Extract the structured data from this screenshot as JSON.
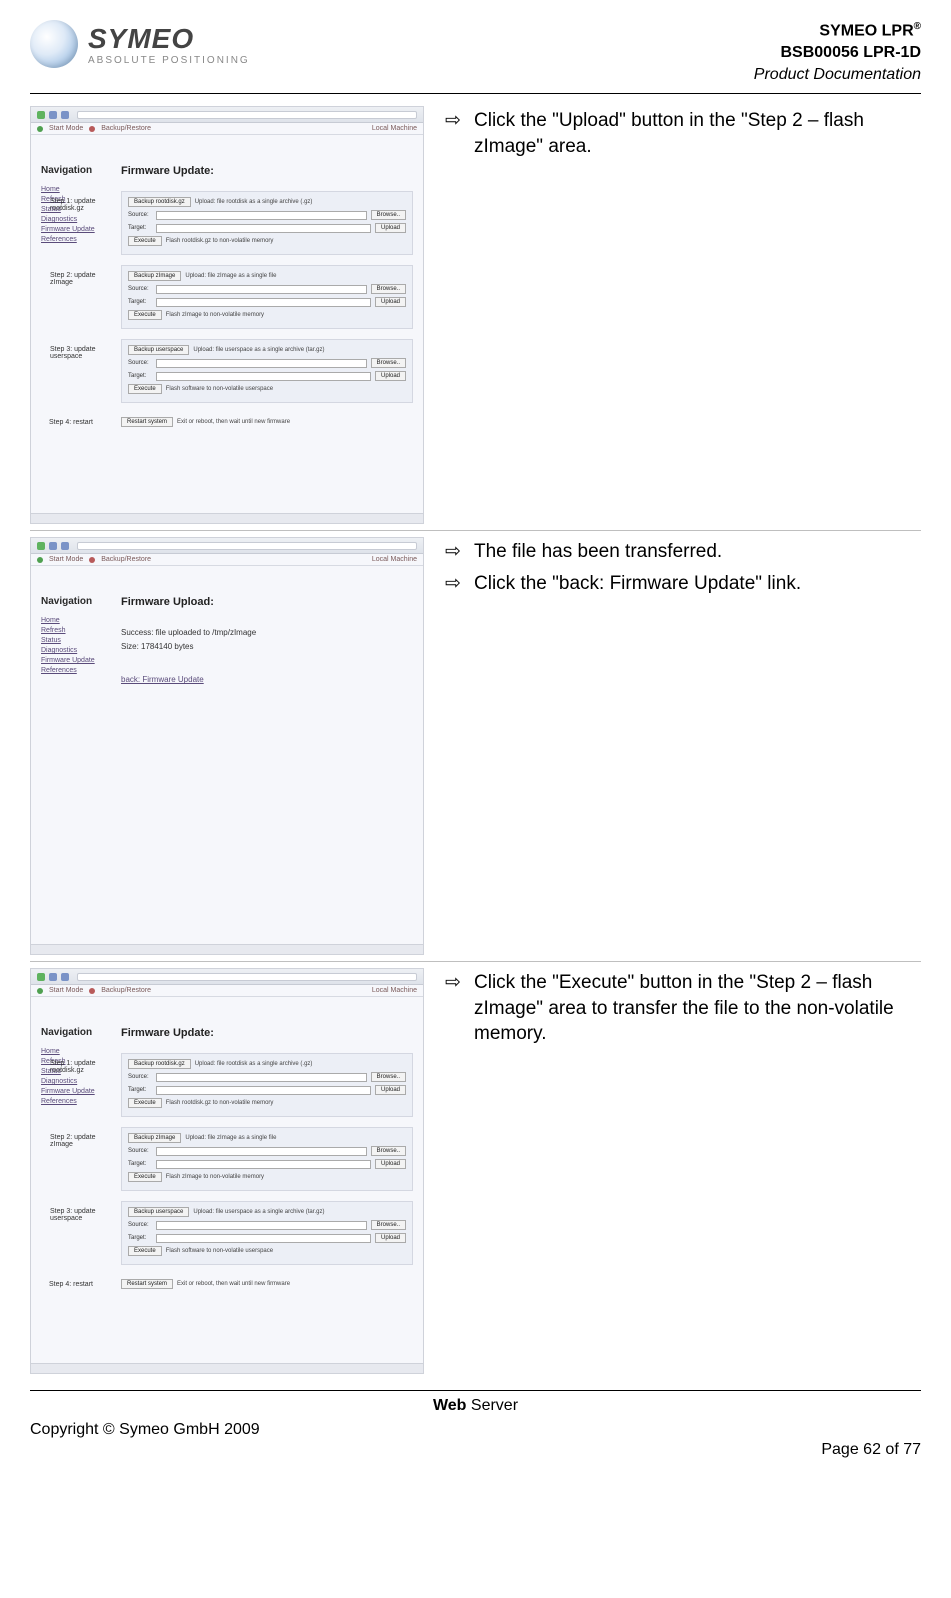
{
  "header": {
    "logo_name": "SYMEO",
    "logo_tagline": "ABSOLUTE POSITIONING",
    "line1": "SYMEO LPR",
    "line1_sup": "®",
    "line2": "BSB00056 LPR-1D",
    "line3": "Product Documentation"
  },
  "rows": [
    {
      "instructions": [
        "Click the \"Upload\" button in the \"Step 2 – flash zImage\" area."
      ],
      "thumb": {
        "type": "update"
      }
    },
    {
      "instructions": [
        "The file has been transferred.",
        "Click the \"back: Firmware Update\" link."
      ],
      "thumb": {
        "type": "upload"
      }
    },
    {
      "instructions": [
        "Click the \"Execute\" button in the \"Step 2 – flash zImage\" area to transfer the file to the non-volatile memory."
      ],
      "thumb": {
        "type": "update"
      }
    }
  ],
  "thumb_common": {
    "nav_title": "Navigation",
    "nav_items": [
      "Home",
      "Refresh",
      "Status",
      "Diagnostics",
      "Firmware Update",
      "References"
    ],
    "logo_name": "SYMEO"
  },
  "thumb_update": {
    "title": "Firmware Update:",
    "steps": [
      {
        "label": "Step 1: update rootdisk.gz",
        "backup": "Backup rootdisk.gz",
        "backup_note": "Upload: file rootdisk as a single archive (.gz)",
        "src": "Source:",
        "tgt": "Target:",
        "browse": "Browse..",
        "upload": "Upload",
        "exec": "Execute",
        "exec_note": "Flash rootdisk.gz to non-volatile memory"
      },
      {
        "label": "Step 2: update zImage",
        "backup": "Backup zImage",
        "backup_note": "Upload: file zImage as a single file",
        "src": "Source:",
        "tgt": "Target:",
        "browse": "Browse..",
        "upload": "Upload",
        "exec": "Execute",
        "exec_note": "Flash zImage to non-volatile memory"
      },
      {
        "label": "Step 3: update userspace",
        "backup": "Backup userspace",
        "backup_note": "Upload: file userspace as a single archive (tar.gz)",
        "src": "Source:",
        "tgt": "Target:",
        "browse": "Browse..",
        "upload": "Upload",
        "exec": "Execute",
        "exec_note": "Flash software to non-volatile userspace"
      },
      {
        "label": "Step 4: restart",
        "btn": "Restart system",
        "note": "Exit or reboot, then wait until new firmware"
      }
    ]
  },
  "thumb_upload": {
    "title": "Firmware Upload:",
    "line1": "Success: file uploaded to /tmp/zImage",
    "line2": "Size: 1784140 bytes",
    "link": "back: Firmware Update"
  },
  "footer": {
    "center_bold": "Web",
    "center_rest": " Server",
    "copyright": "Copyright © Symeo GmbH 2009",
    "page": "Page 62 of 77"
  }
}
